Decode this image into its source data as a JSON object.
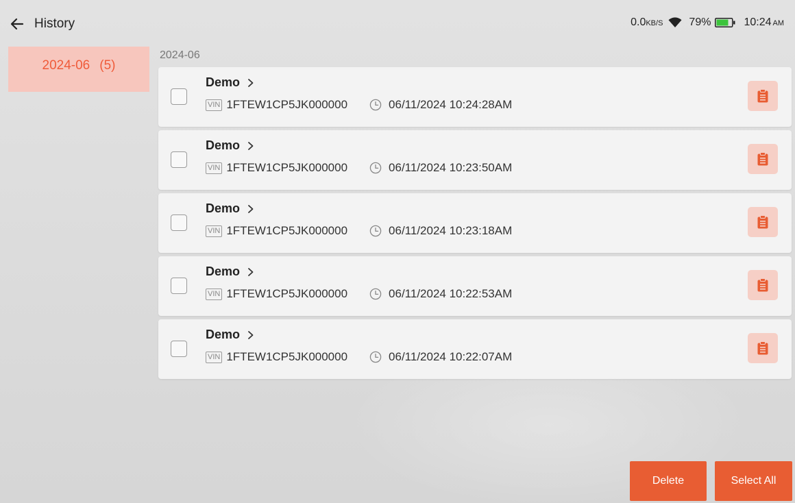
{
  "header": {
    "title": "History",
    "back_icon": "arrow-left-icon"
  },
  "status_bar": {
    "net_speed": "0.0",
    "net_unit": "KB/S",
    "battery_percent": "79%",
    "time": "10:24",
    "time_suffix": "AM",
    "battery_level": 0.79,
    "battery_color": "#3cc43c"
  },
  "sidebar": {
    "tabs": [
      {
        "label": "2024-06",
        "count": "(5)"
      }
    ]
  },
  "main": {
    "group_label": "2024-06",
    "records": [
      {
        "name": "Demo",
        "vin_badge": "VIN",
        "vin": "1FTEW1CP5JK000000",
        "datetime": "06/11/2024 10:24:28AM"
      },
      {
        "name": "Demo",
        "vin_badge": "VIN",
        "vin": "1FTEW1CP5JK000000",
        "datetime": "06/11/2024 10:23:50AM"
      },
      {
        "name": "Demo",
        "vin_badge": "VIN",
        "vin": "1FTEW1CP5JK000000",
        "datetime": "06/11/2024 10:23:18AM"
      },
      {
        "name": "Demo",
        "vin_badge": "VIN",
        "vin": "1FTEW1CP5JK000000",
        "datetime": "06/11/2024 10:22:53AM"
      },
      {
        "name": "Demo",
        "vin_badge": "VIN",
        "vin": "1FTEW1CP5JK000000",
        "datetime": "06/11/2024 10:22:07AM"
      }
    ]
  },
  "actions": {
    "delete_label": "Delete",
    "select_all_label": "Select All"
  },
  "colors": {
    "accent": "#e85d33",
    "tab_bg": "#f7c6bd",
    "tab_text": "#ef5b3a",
    "report_bg": "#f6cfc6"
  }
}
